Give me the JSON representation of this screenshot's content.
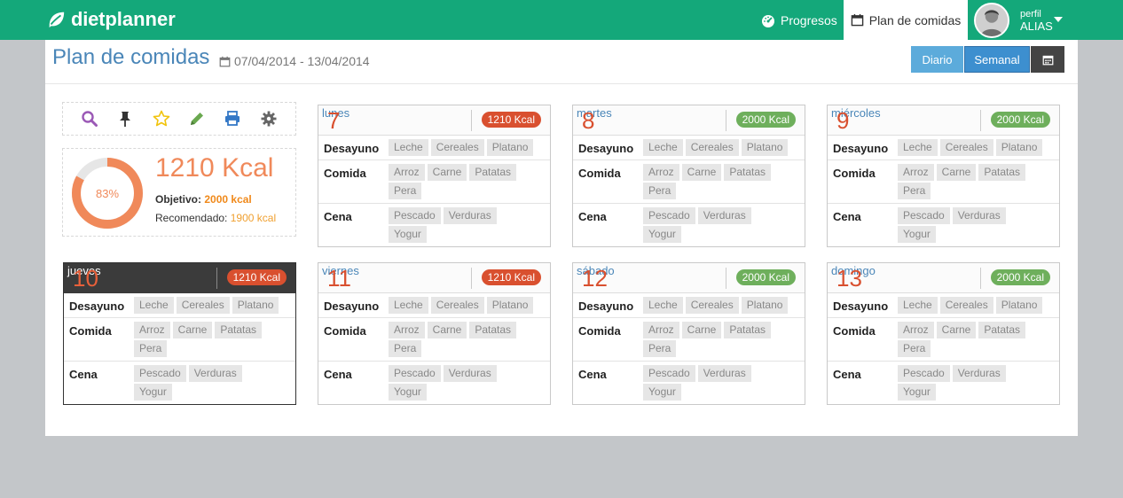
{
  "nav": {
    "brand_diet": "diet",
    "brand_planner": "planner",
    "progress_label": "Progresos",
    "plan_label": "Plan de comidas",
    "profile_small": "perfil",
    "profile_alias": "ALIAS"
  },
  "page": {
    "title": "Plan de comidas",
    "date_range": "07/04/2014 - 13/04/2014",
    "btn_daily": "Diario",
    "btn_weekly": "Semanal"
  },
  "summary": {
    "percent": "83%",
    "percent_value": 0.83,
    "kcal": "1210 Kcal",
    "goal_label": "Objetivo:",
    "goal_value": "2000 kcal",
    "rec_label": "Recomendado:",
    "rec_value": "1900 kcal"
  },
  "colors": {
    "navbar": "#14a87a",
    "accent_orange": "#f0895a",
    "badge_red": "#d9502f",
    "badge_green": "#6eaf5c",
    "title_blue": "#4a86b8"
  },
  "toolbar_icons": [
    "search-icon",
    "pin-icon",
    "star-icon",
    "pencil-icon",
    "print-icon",
    "gear-icon"
  ],
  "meal_labels": {
    "breakfast": "Desayuno",
    "lunch": "Comida",
    "dinner": "Cena"
  },
  "days": [
    {
      "num": "7",
      "name": "lunes",
      "kcal": "1210 Kcal",
      "badge": "red",
      "breakfast": [
        "Leche",
        "Cereales",
        "Platano"
      ],
      "lunch": [
        "Arroz",
        "Carne",
        "Patatas",
        "Pera"
      ],
      "dinner": [
        "Pescado",
        "Verduras",
        "Yogur"
      ]
    },
    {
      "num": "8",
      "name": "martes",
      "kcal": "2000 Kcal",
      "badge": "green",
      "breakfast": [
        "Leche",
        "Cereales",
        "Platano"
      ],
      "lunch": [
        "Arroz",
        "Carne",
        "Patatas",
        "Pera"
      ],
      "dinner": [
        "Pescado",
        "Verduras",
        "Yogur"
      ]
    },
    {
      "num": "9",
      "name": "miércoles",
      "kcal": "2000 Kcal",
      "badge": "green",
      "breakfast": [
        "Leche",
        "Cereales",
        "Platano"
      ],
      "lunch": [
        "Arroz",
        "Carne",
        "Patatas",
        "Pera"
      ],
      "dinner": [
        "Pescado",
        "Verduras",
        "Yogur"
      ]
    },
    {
      "num": "10",
      "name": "jueves",
      "kcal": "1210 Kcal",
      "badge": "red",
      "breakfast": [
        "Leche",
        "Cereales",
        "Platano"
      ],
      "lunch": [
        "Arroz",
        "Carne",
        "Patatas",
        "Pera"
      ],
      "dinner": [
        "Pescado",
        "Verduras",
        "Yogur"
      ]
    },
    {
      "num": "11",
      "name": "viernes",
      "kcal": "1210 Kcal",
      "badge": "red",
      "breakfast": [
        "Leche",
        "Cereales",
        "Platano"
      ],
      "lunch": [
        "Arroz",
        "Carne",
        "Patatas",
        "Pera"
      ],
      "dinner": [
        "Pescado",
        "Verduras",
        "Yogur"
      ]
    },
    {
      "num": "12",
      "name": "sábado",
      "kcal": "2000 Kcal",
      "badge": "green",
      "breakfast": [
        "Leche",
        "Cereales",
        "Platano"
      ],
      "lunch": [
        "Arroz",
        "Carne",
        "Patatas",
        "Pera"
      ],
      "dinner": [
        "Pescado",
        "Verduras",
        "Yogur"
      ]
    },
    {
      "num": "13",
      "name": "domingo",
      "kcal": "2000 Kcal",
      "badge": "green",
      "breakfast": [
        "Leche",
        "Cereales",
        "Platano"
      ],
      "lunch": [
        "Arroz",
        "Carne",
        "Patatas",
        "Pera"
      ],
      "dinner": [
        "Pescado",
        "Verduras",
        "Yogur"
      ]
    }
  ]
}
